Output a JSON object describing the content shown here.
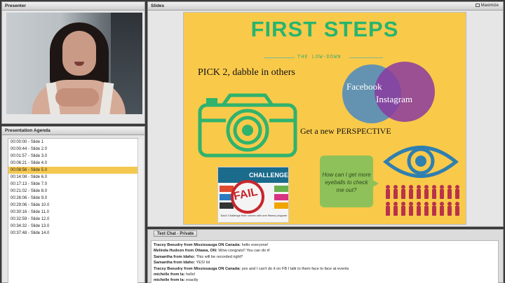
{
  "presenter": {
    "title": "Presenter"
  },
  "agenda": {
    "title": "Presentation Agenda",
    "items": [
      "00:00:00 - Slide 1",
      "00:00:44 - Slide 2.0",
      "00:01:57 - Slide 3.0",
      "00:06:21 - Slide 4.0",
      "00:08:56 - Slide 5.0",
      "00:14:08 - Slide 6.0",
      "00:17:13 - Slide 7.0",
      "00:21:02 - Slide 8.0",
      "00:26:06 - Slide 9.0",
      "00:29:06 - Slide 10.0",
      "00:30:16 - Slide 11.0",
      "00:32:59 - Slide 12.0",
      "00:34:32 - Slide 13.0",
      "00:37:48 - Slide 14.0"
    ],
    "selected_index": 4,
    "selected_color": "#f4c84f"
  },
  "slides": {
    "title": "Slides",
    "maximize_label": "Maximize",
    "slide": {
      "title": "FIRST STEPS",
      "subtitle": "THE LOW-DOWN",
      "pick_text": "PICK 2, dabble in others",
      "venn_left": "Facebook",
      "venn_right": "Instagram",
      "perspective_text": "Get a new PERSPECTIVE",
      "bubble_text": "How can I get more eyeballs to check me out?",
      "promo_brand": "CHALLENGE",
      "promo_fail": "FAIL",
      "promo_caption": "Each Challenge their comes with one fitness program",
      "background_color": "#f9c94a",
      "accent_color": "#27b56e"
    }
  },
  "chat": {
    "tab_label": "Text Chat - Private",
    "messages": [
      {
        "from": "Tracey Beeudry from Mississauga ON Canada:",
        "text": " hello everyone!"
      },
      {
        "from": "Melinda Hudson from Ottawa, ON:",
        "text": " Wow congrats!! You can do it!"
      },
      {
        "from": "Samantha from Idaho:",
        "text": " This will be recorded right?"
      },
      {
        "from": "Samantha from Idaho:",
        "text": " YES! lol"
      },
      {
        "from": "Tracey Beeudry from Mississauga ON Canada:",
        "text": " yes and I can't do it on FB I talk to them face to face at events"
      },
      {
        "from": "michelle from la:",
        "text": " hello!"
      },
      {
        "from": "michelle from la:",
        "text": " exactly"
      }
    ]
  }
}
